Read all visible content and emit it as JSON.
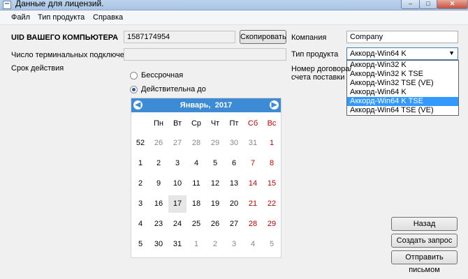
{
  "window": {
    "title": "Данные для лицензий.",
    "controls": {
      "minimize": "–",
      "maximize": "□",
      "close": "✕"
    }
  },
  "menu": {
    "items": [
      "Файл",
      "Тип продукта",
      "Справка"
    ]
  },
  "form": {
    "uid_label": "UID ВАШЕГО КОМПЬЮТЕРА",
    "uid_value": "1587174954",
    "copy_button": "Скопировать",
    "terminals_label": "Число терминальных подключений",
    "terminals_value": "",
    "validity_label": "Срок действия",
    "radio_unlimited": "Бессрочная",
    "radio_valid_until": "Действительна до",
    "company_label": "Компания",
    "company_value": "Company",
    "product_type_label": "Тип продукта",
    "product_selected": "Аккорд-Win64 K",
    "product_options": [
      "Аккорд-Win32 K",
      "Аккорд-Win32 K TSE",
      "Аккорд-Win32 TSE (VE)",
      "Аккорд-Win64 K",
      "Аккорд-Win64 K TSE",
      "Аккорд-Win64 TSE (VE)"
    ],
    "product_highlighted_index": 4,
    "contract_label_1": "Номер договора/",
    "contract_label_2": "счета поставки"
  },
  "calendar": {
    "month": "Январь,",
    "year": "2017",
    "weekdays": [
      "Пн",
      "Вт",
      "Ср",
      "Чт",
      "Пт",
      "Сб",
      "Вс"
    ],
    "weeks": [
      {
        "num": "52",
        "days": [
          "26",
          "27",
          "28",
          "29",
          "30",
          "31",
          "1"
        ]
      },
      {
        "num": "1",
        "days": [
          "2",
          "3",
          "4",
          "5",
          "6",
          "7",
          "8"
        ]
      },
      {
        "num": "2",
        "days": [
          "9",
          "10",
          "11",
          "12",
          "13",
          "14",
          "15"
        ]
      },
      {
        "num": "3",
        "days": [
          "16",
          "17",
          "18",
          "19",
          "20",
          "21",
          "22"
        ]
      },
      {
        "num": "4",
        "days": [
          "23",
          "24",
          "25",
          "26",
          "27",
          "28",
          "29"
        ]
      },
      {
        "num": "5",
        "days": [
          "30",
          "31",
          "1",
          "2",
          "3",
          "4",
          "5"
        ]
      }
    ],
    "selected_day": "17"
  },
  "actions": {
    "back": "Назад",
    "create_request": "Создать запрос",
    "send_email": "Отправить письмом"
  }
}
